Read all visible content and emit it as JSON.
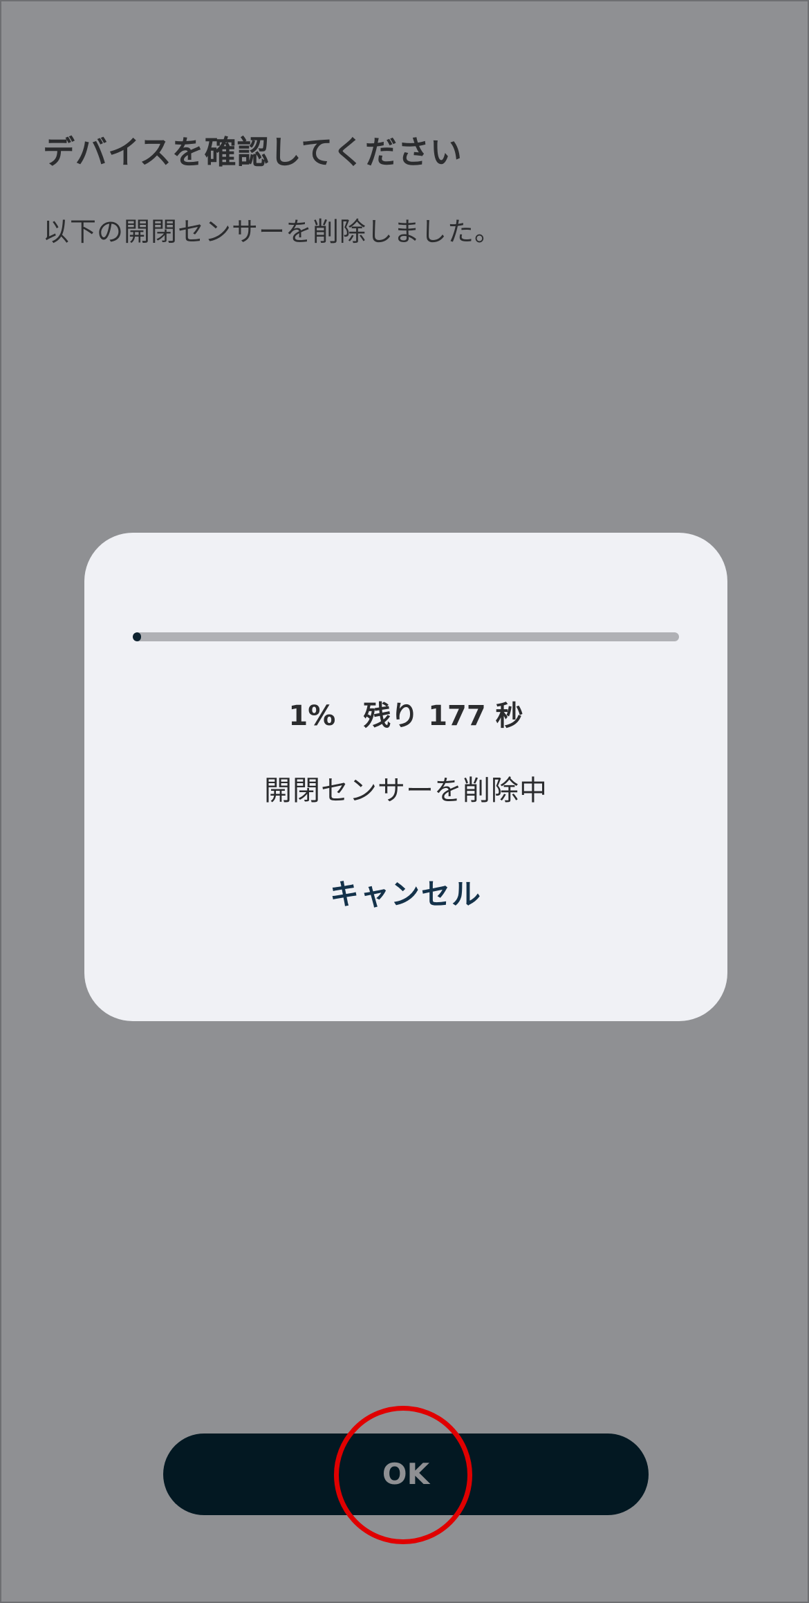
{
  "page": {
    "title": "デバイスを確認してください",
    "description": "以下の開閉センサーを削除しました。"
  },
  "dialog": {
    "progress_percent": 1,
    "progress_text": "1%　残り 177 秒",
    "status_text": "開閉センサーを削除中",
    "cancel_label": "キャンセル"
  },
  "footer": {
    "ok_label": "OK"
  },
  "colors": {
    "background": "#8f9093",
    "dialog_background": "#f0f1f5",
    "progress_fill": "#0f2330",
    "progress_track": "#b0b1b5",
    "cancel_text": "#14324a",
    "ok_button_background": "#031822",
    "highlight": "#e00000"
  }
}
